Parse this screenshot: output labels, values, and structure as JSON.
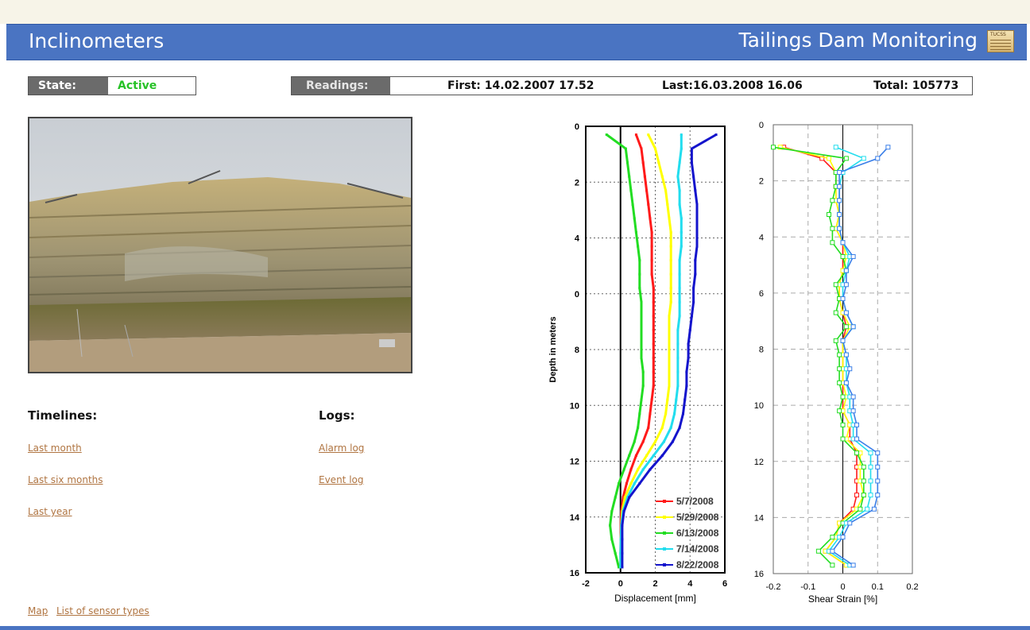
{
  "header": {
    "title": "Inclinometers",
    "app_name": "Tailings Dam Monitoring",
    "logo_text": "TUCSS"
  },
  "status": {
    "state_label": "State:",
    "state_value": "Active",
    "state_color": "#27c227",
    "readings_label": "Readings:",
    "first_label": "First:",
    "first_value": "14.02.2007 17.52",
    "last_label": "Last:",
    "last_value": "16.03.2008 16.06",
    "total_label": "Total:",
    "total_value": "105773"
  },
  "timelines": {
    "title": "Timelines:",
    "links": [
      "Last month",
      "Last six months",
      "Last year"
    ]
  },
  "logs": {
    "title": "Logs:",
    "links": [
      "Alarm log",
      "Event log"
    ]
  },
  "footer": {
    "links": [
      "Map",
      "List of sensor types"
    ]
  },
  "colors": {
    "header_bg": "#4a74c2",
    "link": "#b07542",
    "label_bg": "#6b6b6b"
  },
  "chart_data": [
    {
      "type": "line",
      "xlabel": "Displacement [mm]",
      "ylabel": "Depth in meters",
      "xlim": [
        -2,
        6
      ],
      "ylim": [
        0,
        16
      ],
      "y_inverted": true,
      "xticks": [
        -2,
        0,
        2,
        4,
        6
      ],
      "yticks": [
        0,
        2,
        4,
        6,
        8,
        10,
        12,
        14,
        16
      ],
      "ytick_labels": [
        "0",
        "2",
        "4",
        "0",
        "8",
        "10",
        "12",
        "14",
        "16"
      ],
      "grid": "dotted",
      "legend_placement": "bottom-right",
      "depth": [
        0.3,
        0.8,
        1.3,
        1.8,
        2.3,
        2.8,
        3.3,
        3.8,
        4.3,
        4.8,
        5.3,
        5.8,
        6.3,
        6.8,
        7.3,
        7.8,
        8.3,
        8.8,
        9.3,
        9.8,
        10.3,
        10.8,
        11.3,
        11.8,
        12.3,
        12.8,
        13.3,
        13.8,
        14.3,
        14.8,
        15.3,
        15.8
      ],
      "series": [
        {
          "name": "5/7/2008",
          "color": "#ff1a1a",
          "values": [
            0.9,
            1.2,
            1.3,
            1.4,
            1.5,
            1.6,
            1.7,
            1.8,
            1.8,
            1.8,
            1.8,
            1.9,
            1.9,
            1.9,
            1.9,
            1.9,
            1.9,
            1.9,
            1.9,
            1.8,
            1.7,
            1.6,
            1.3,
            0.9,
            0.6,
            0.35,
            0.15,
            0.05,
            0.02,
            0.01,
            0.0,
            0.0
          ]
        },
        {
          "name": "5/29/2008",
          "color": "#ffff00",
          "values": [
            1.6,
            2.0,
            2.2,
            2.4,
            2.6,
            2.7,
            2.8,
            2.9,
            2.9,
            2.9,
            2.9,
            2.9,
            2.9,
            2.8,
            2.8,
            2.8,
            2.8,
            2.8,
            2.8,
            2.7,
            2.6,
            2.4,
            2.0,
            1.5,
            1.0,
            0.6,
            0.25,
            0.1,
            0.05,
            0.02,
            0.0,
            0.0
          ]
        },
        {
          "name": "6/13/2008",
          "color": "#22dd22",
          "values": [
            -0.8,
            0.3,
            0.4,
            0.5,
            0.6,
            0.7,
            0.8,
            0.9,
            1.0,
            1.1,
            1.1,
            1.1,
            1.2,
            1.2,
            1.2,
            1.2,
            1.2,
            1.3,
            1.3,
            1.2,
            1.1,
            1.0,
            0.8,
            0.5,
            0.2,
            -0.1,
            -0.3,
            -0.5,
            -0.6,
            -0.5,
            -0.3,
            -0.1
          ]
        },
        {
          "name": "7/14/2008",
          "color": "#22ddee",
          "values": [
            3.5,
            3.5,
            3.4,
            3.3,
            3.4,
            3.4,
            3.5,
            3.5,
            3.5,
            3.4,
            3.4,
            3.4,
            3.4,
            3.4,
            3.3,
            3.3,
            3.3,
            3.3,
            3.3,
            3.2,
            3.1,
            2.9,
            2.5,
            1.9,
            1.3,
            0.8,
            0.4,
            0.15,
            0.05,
            0.02,
            0.0,
            0.0
          ]
        },
        {
          "name": "8/22/2008",
          "color": "#1414cc",
          "values": [
            5.5,
            4.1,
            4.1,
            4.2,
            4.3,
            4.4,
            4.4,
            4.4,
            4.4,
            4.3,
            4.3,
            4.2,
            4.2,
            4.1,
            4.0,
            3.9,
            3.9,
            3.8,
            3.8,
            3.7,
            3.6,
            3.4,
            3.0,
            2.4,
            1.7,
            1.1,
            0.5,
            0.2,
            0.1,
            0.1,
            0.1,
            0.1
          ]
        }
      ]
    },
    {
      "type": "line",
      "xlabel": "Shear Strain [%]",
      "xlim": [
        -0.2,
        0.2
      ],
      "ylim": [
        0,
        16
      ],
      "y_inverted": true,
      "xticks": [
        -0.2,
        -0.1,
        0,
        0.1,
        0.2
      ],
      "yticks": [
        0,
        2,
        4,
        6,
        8,
        10,
        12,
        14,
        16
      ],
      "grid": "dashed",
      "depth": [
        0.8,
        1.2,
        1.7,
        2.2,
        2.7,
        3.2,
        3.7,
        4.2,
        4.7,
        5.2,
        5.7,
        6.2,
        6.7,
        7.2,
        7.7,
        8.2,
        8.7,
        9.2,
        9.7,
        10.2,
        10.7,
        11.2,
        11.7,
        12.2,
        12.7,
        13.2,
        13.7,
        14.2,
        14.7,
        15.2,
        15.7
      ],
      "series": [
        {
          "name": "5/7/2008",
          "color": "#ff1a1a",
          "values": [
            -0.17,
            -0.06,
            -0.02,
            -0.02,
            -0.02,
            -0.01,
            -0.02,
            0.0,
            0.0,
            0.0,
            -0.01,
            -0.01,
            0.0,
            0.01,
            0.0,
            0.0,
            0.0,
            0.0,
            0.0,
            0.0,
            0.02,
            0.02,
            0.04,
            0.04,
            0.04,
            0.04,
            0.03,
            -0.01,
            -0.02,
            -0.05,
            0.01
          ]
        },
        {
          "name": "5/29/2008",
          "color": "#ffff00",
          "values": [
            -0.18,
            -0.04,
            -0.02,
            -0.02,
            -0.02,
            -0.01,
            -0.02,
            0.0,
            0.01,
            0.0,
            -0.01,
            -0.01,
            0.0,
            0.02,
            0.0,
            0.0,
            0.0,
            0.0,
            0.01,
            0.0,
            0.02,
            0.01,
            0.05,
            0.05,
            0.05,
            0.06,
            0.04,
            -0.01,
            -0.02,
            -0.05,
            0.01
          ]
        },
        {
          "name": "6/13/2008",
          "color": "#22dd22",
          "values": [
            -0.2,
            0.01,
            -0.02,
            -0.02,
            -0.03,
            -0.04,
            -0.03,
            -0.03,
            0.0,
            0.01,
            -0.02,
            -0.01,
            -0.02,
            0.01,
            -0.02,
            -0.01,
            -0.01,
            -0.01,
            0.0,
            -0.01,
            0.0,
            0.0,
            0.04,
            0.06,
            0.06,
            0.06,
            0.05,
            0.0,
            -0.03,
            -0.07,
            -0.03
          ]
        },
        {
          "name": "7/14/2008",
          "color": "#22ddee",
          "values": [
            -0.02,
            0.06,
            0.0,
            -0.01,
            -0.01,
            -0.01,
            -0.01,
            0.0,
            0.02,
            0.01,
            0.0,
            0.0,
            0.01,
            0.03,
            0.0,
            0.01,
            0.01,
            0.01,
            0.02,
            0.02,
            0.03,
            0.03,
            0.08,
            0.08,
            0.08,
            0.08,
            0.07,
            0.01,
            -0.01,
            -0.04,
            0.02
          ]
        },
        {
          "name": "8/22/2008",
          "color": "#3a7fe8",
          "values": [
            0.13,
            0.1,
            -0.01,
            -0.01,
            -0.01,
            -0.01,
            -0.01,
            0.0,
            0.03,
            0.01,
            0.01,
            0.0,
            0.01,
            0.03,
            0.0,
            0.01,
            0.02,
            0.01,
            0.03,
            0.03,
            0.04,
            0.04,
            0.1,
            0.1,
            0.1,
            0.1,
            0.09,
            0.02,
            0.0,
            -0.03,
            0.03
          ]
        }
      ]
    }
  ]
}
